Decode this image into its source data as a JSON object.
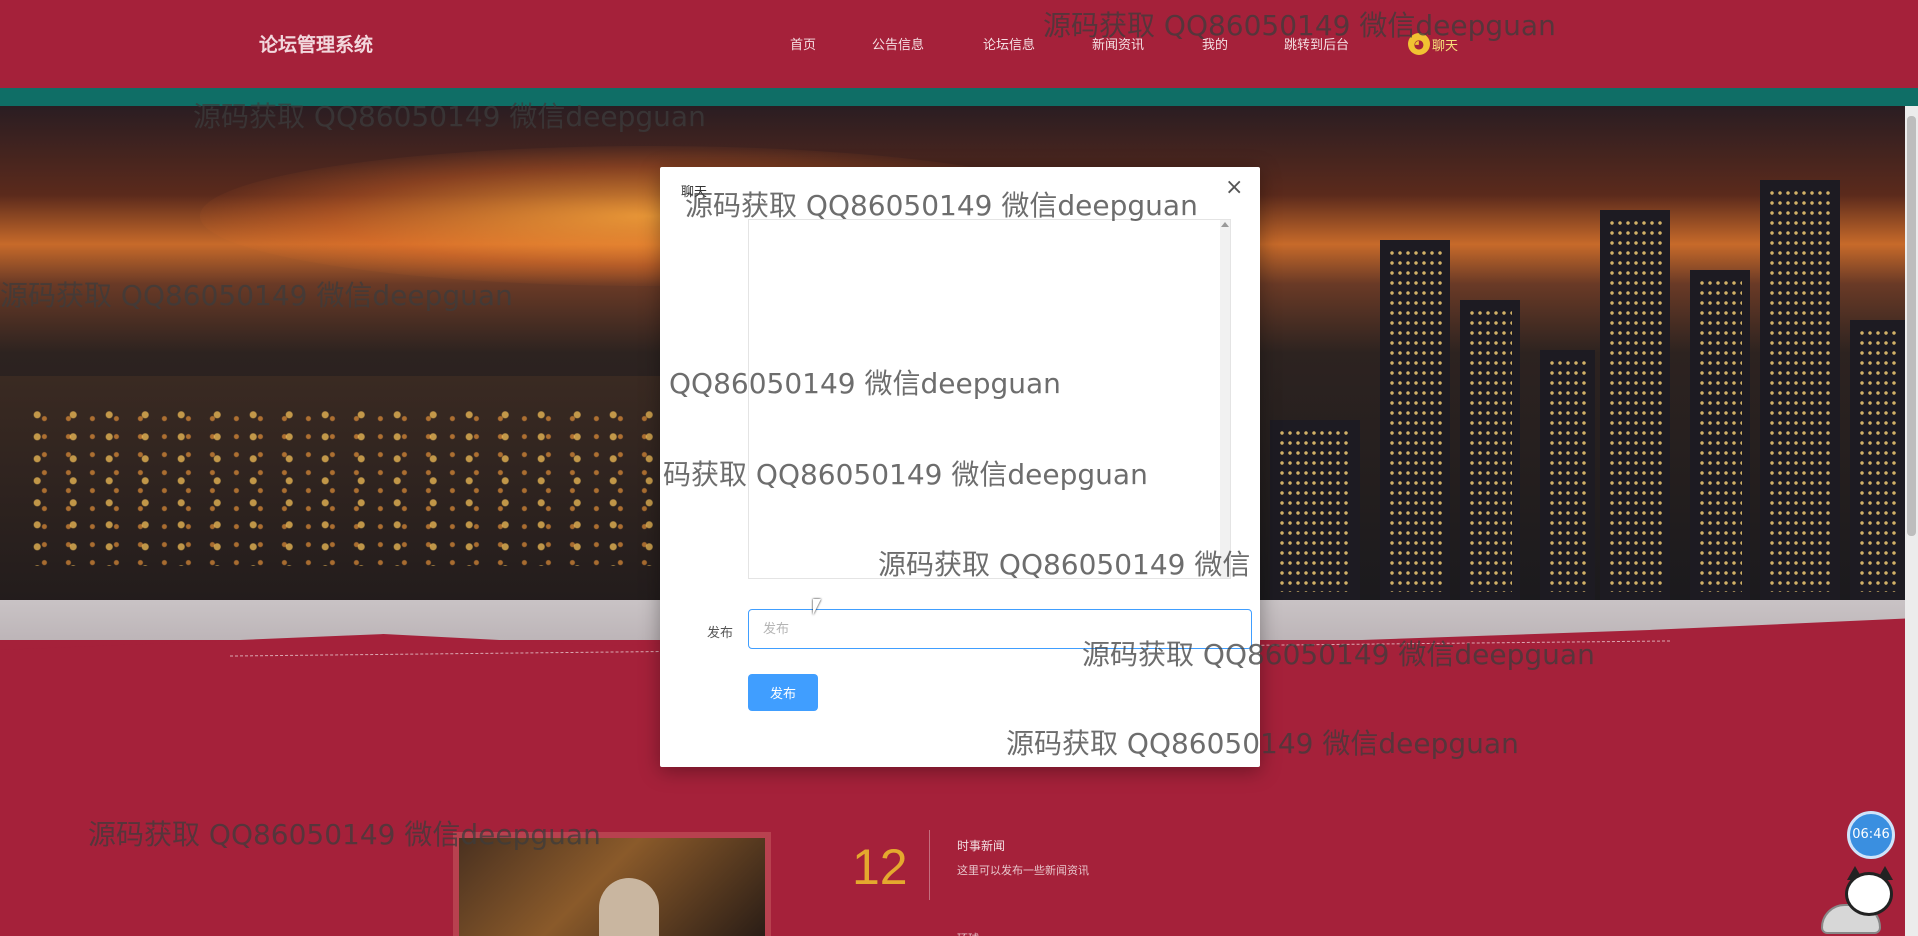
{
  "header": {
    "brand": "论坛管理系统",
    "nav": [
      "首页",
      "公告信息",
      "论坛信息",
      "新闻资讯",
      "我的",
      "跳转到后台"
    ],
    "chat_label": "聊天"
  },
  "modal": {
    "title": "聊天",
    "close_glyph": "×",
    "label": "发布",
    "input_placeholder": "发布",
    "submit_label": "发布"
  },
  "news": {
    "day": "12",
    "title": "时事新闻",
    "desc": "这里可以发布一些新闻资讯",
    "next": "环球"
  },
  "widget": {
    "clock_time": "06:46"
  },
  "watermark": "源码获取 QQ86050149 微信deepguan",
  "watermark_partials": [
    "源码获取 QQ86050149 微信",
    "码获取 QQ86050149 微信deepguan",
    "QQ86050149 微信deepguan"
  ],
  "colors": {
    "page_bg": "#a5213a",
    "nav_strip": "#0f6e66",
    "primary_button": "#409eff",
    "accent_number": "#e4a92e"
  }
}
